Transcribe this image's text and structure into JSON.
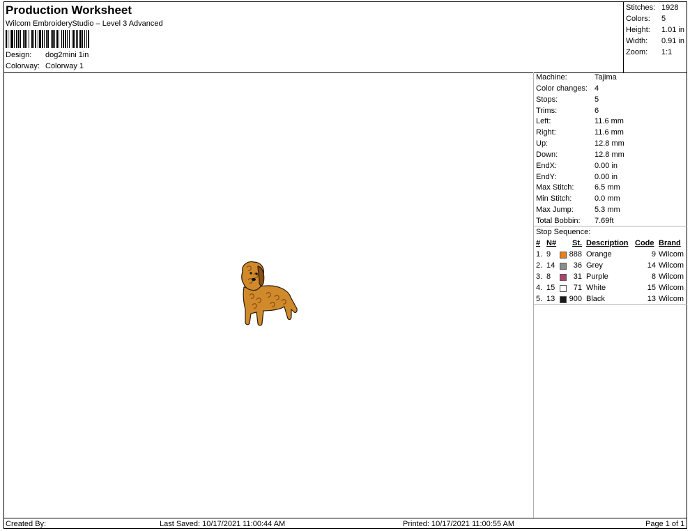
{
  "header": {
    "title": "Production Worksheet",
    "software": "Wilcom EmbroideryStudio – Level 3 Advanced",
    "design_label": "Design:",
    "design_value": "dog2mini 1in",
    "colorway_label": "Colorway:",
    "colorway_value": "Colorway 1"
  },
  "stats": [
    {
      "label": "Stitches:",
      "value": "1928"
    },
    {
      "label": "Colors:",
      "value": "5"
    },
    {
      "label": "Height:",
      "value": "1.01 in"
    },
    {
      "label": "Width:",
      "value": "0.91 in"
    },
    {
      "label": "Zoom:",
      "value": "1:1"
    }
  ],
  "machine_info": [
    {
      "label": "Machine:",
      "value": "Tajima"
    },
    {
      "label": "Color changes:",
      "value": "4"
    },
    {
      "label": "Stops:",
      "value": "5"
    },
    {
      "label": "Trims:",
      "value": "6"
    },
    {
      "label": "Left:",
      "value": "11.6 mm"
    },
    {
      "label": "Right:",
      "value": "11.6 mm"
    },
    {
      "label": "Up:",
      "value": "12.8 mm"
    },
    {
      "label": "Down:",
      "value": "12.8 mm"
    },
    {
      "label": "EndX:",
      "value": "0.00 in"
    },
    {
      "label": "EndY:",
      "value": "0.00 in"
    },
    {
      "label": "Max Stitch:",
      "value": "6.5 mm"
    },
    {
      "label": "Min Stitch:",
      "value": "0.0 mm"
    },
    {
      "label": "Max Jump:",
      "value": "5.3 mm"
    },
    {
      "label": "Total Bobbin:",
      "value": "7.69ft"
    }
  ],
  "stop_sequence": {
    "title": "Stop Sequence:",
    "headers": {
      "num": "#",
      "n": "N#",
      "st": "St.",
      "desc": "Description",
      "code": "Code",
      "brand": "Brand"
    },
    "rows": [
      {
        "num": "1.",
        "n": "9",
        "color": "#e8801a",
        "st": "888",
        "desc": "Orange",
        "code": "9",
        "brand": "Wilcom"
      },
      {
        "num": "2.",
        "n": "14",
        "color": "#8c8c8c",
        "st": "36",
        "desc": "Grey",
        "code": "14",
        "brand": "Wilcom"
      },
      {
        "num": "3.",
        "n": "8",
        "color": "#a8456e",
        "st": "31",
        "desc": "Purple",
        "code": "8",
        "brand": "Wilcom"
      },
      {
        "num": "4.",
        "n": "15",
        "color": "#ffffff",
        "st": "71",
        "desc": "White",
        "code": "15",
        "brand": "Wilcom"
      },
      {
        "num": "5.",
        "n": "13",
        "color": "#1a1a1a",
        "st": "900",
        "desc": "Black",
        "code": "13",
        "brand": "Wilcom"
      }
    ]
  },
  "footer": {
    "created_by": "Created By:",
    "last_saved": "Last Saved: 10/17/2021 11:00:44 AM",
    "printed": "Printed: 10/17/2021 11:00:55 AM",
    "page": "Page 1 of 1"
  },
  "colors": {
    "dog_body": "#d08a2c",
    "dog_shadow": "#8a4e12",
    "dog_outline": "#2a1a0a"
  }
}
